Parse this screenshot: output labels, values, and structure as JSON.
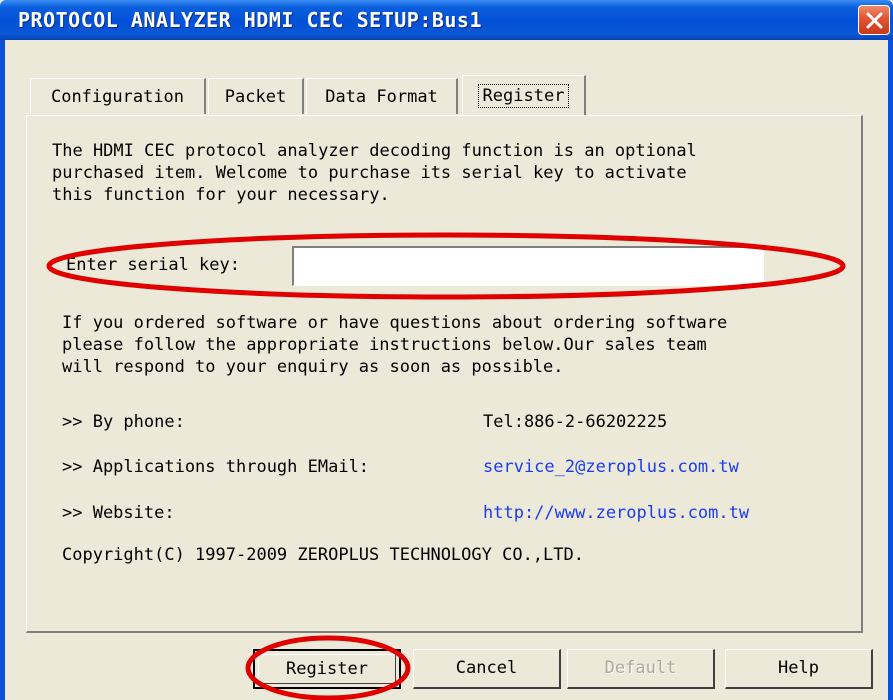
{
  "window": {
    "title": "PROTOCOL ANALYZER HDMI CEC SETUP:Bus1"
  },
  "tabs": [
    {
      "label": "Configuration",
      "active": false
    },
    {
      "label": "Packet",
      "active": false
    },
    {
      "label": "Data Format",
      "active": false
    },
    {
      "label": "Register",
      "active": true
    }
  ],
  "register": {
    "intro": "The HDMI CEC protocol analyzer decoding function is an optional\npurchased item. Welcome to purchase its serial key to activate\nthis function for your necessary.",
    "serial_label": "Enter serial key:",
    "serial_value": "",
    "ordering_text": "If you ordered software or have questions about ordering software\nplease follow the appropriate instructions below.Our sales team\nwill respond to your enquiry as soon as possible.",
    "contacts": [
      {
        "label": ">> By phone:",
        "value": "Tel:886-2-66202225",
        "is_link": false
      },
      {
        "label": ">> Applications through EMail:",
        "value": "service_2@zeroplus.com.tw",
        "is_link": true
      },
      {
        "label": ">> Website:",
        "value": "http://www.zeroplus.com.tw",
        "is_link": true
      }
    ],
    "copyright": "Copyright(C) 1997-2009 ZEROPLUS TECHNOLOGY CO.,LTD."
  },
  "buttons": {
    "register": "Register",
    "cancel": "Cancel",
    "default": "Default",
    "help": "Help"
  },
  "colors": {
    "titlebar": "#0350d8",
    "dialog_bg": "#ece9d8",
    "link": "#1a3cf0",
    "annotation": "#e00000",
    "close_button": "#e05533"
  }
}
